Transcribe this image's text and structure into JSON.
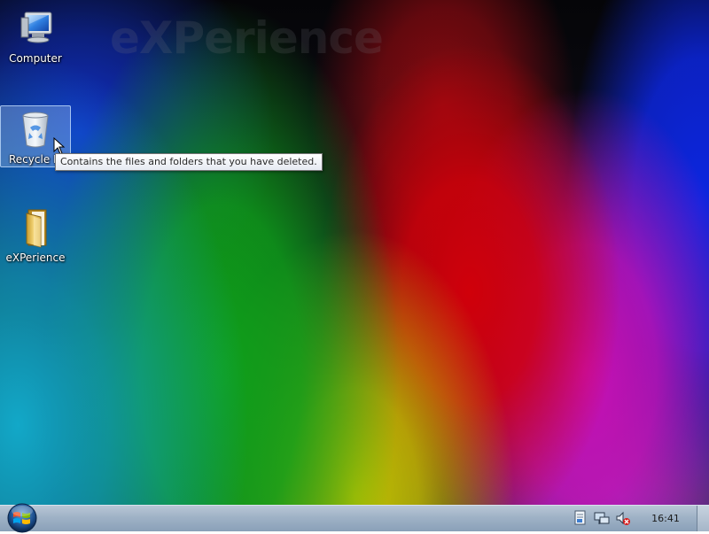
{
  "desktop": {
    "watermark": "eXPerience",
    "icons": [
      {
        "label": "Computer",
        "icon": "computer-icon"
      },
      {
        "label": "Recycle Bin",
        "label_visible": "Recycle B",
        "icon": "recycle-bin-icon",
        "selected": true
      },
      {
        "label": "eXPerience",
        "icon": "folder-icon"
      }
    ],
    "tooltip": "Contains the files and folders that you have deleted."
  },
  "taskbar": {
    "start_icon": "windows-orb-icon",
    "tray_icons": [
      "document-icon",
      "network-icon",
      "volume-muted-icon"
    ],
    "clock": "16:41"
  }
}
